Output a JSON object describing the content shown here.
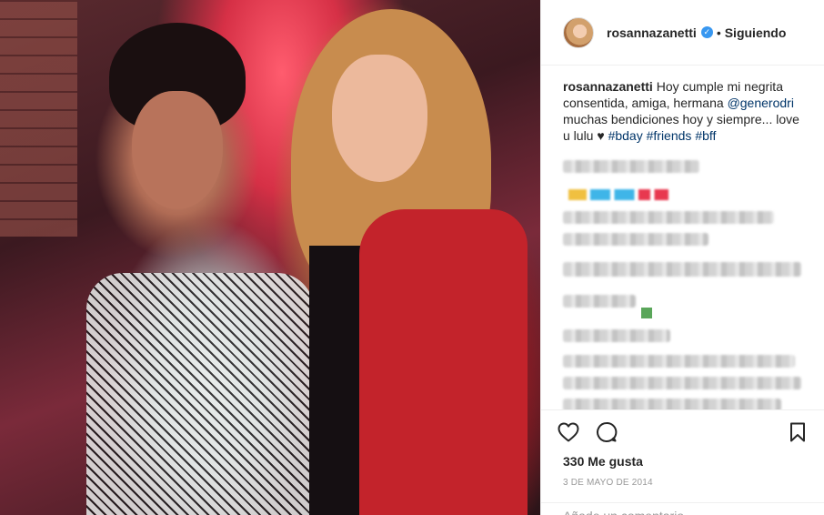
{
  "post": {
    "photo_alt": "Two women posing together"
  },
  "header": {
    "username": "rosannazanetti",
    "verified_icon": "verified-badge-icon",
    "separator": "•",
    "follow_status": "Siguiendo"
  },
  "caption": {
    "username": "rosannazanetti",
    "text_before": "Hoy cumple mi negrita consentida, amiga, hermana ",
    "mention": "@generodri",
    "text_mid": " muchas bendiciones hoy y siempre... love u lulu ♥ ",
    "hashtags": [
      "#bday",
      "#friends",
      "#bff"
    ]
  },
  "actions": {
    "like_icon": "heart-icon",
    "comment_icon": "comment-icon",
    "save_icon": "bookmark-icon",
    "likes_text": "330 Me gusta",
    "date_text": "3 DE MAYO DE 2014"
  },
  "add_comment": {
    "placeholder": "Añade un comentario..."
  },
  "colors": {
    "link": "#003569",
    "verified": "#3897f0",
    "text": "#262626",
    "muted": "#999999"
  }
}
